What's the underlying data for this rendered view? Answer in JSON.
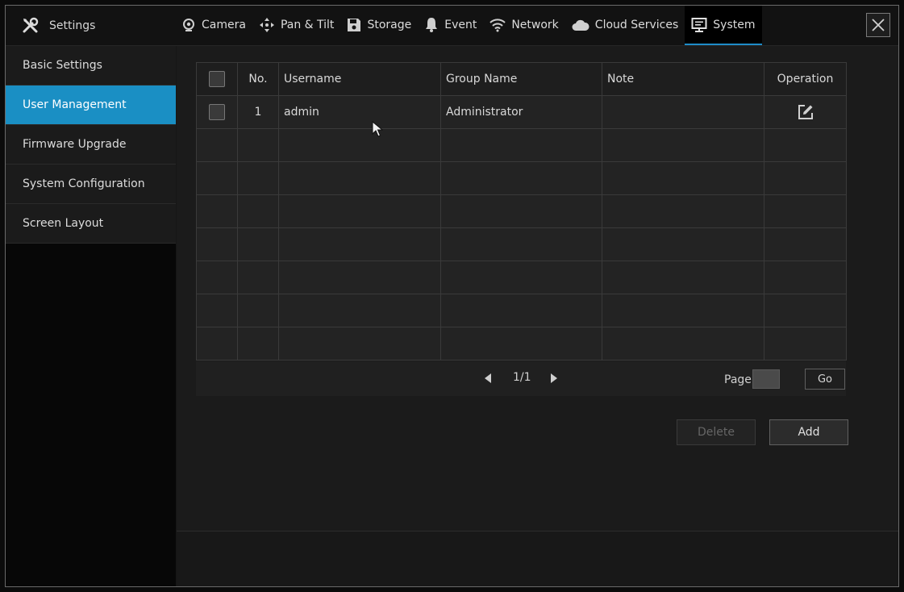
{
  "header": {
    "title": "Settings",
    "tabs": [
      {
        "label": "Camera",
        "icon": "camera-icon"
      },
      {
        "label": "Pan & Tilt",
        "icon": "pan-tilt-icon"
      },
      {
        "label": "Storage",
        "icon": "storage-icon"
      },
      {
        "label": "Event",
        "icon": "bell-icon"
      },
      {
        "label": "Network",
        "icon": "wifi-icon"
      },
      {
        "label": "Cloud Services",
        "icon": "cloud-icon"
      },
      {
        "label": "System",
        "icon": "monitor-icon",
        "active": true
      }
    ]
  },
  "sidebar": {
    "items": [
      {
        "label": "Basic Settings"
      },
      {
        "label": "User Management",
        "active": true
      },
      {
        "label": "Firmware Upgrade"
      },
      {
        "label": "System Configuration"
      },
      {
        "label": "Screen Layout"
      }
    ]
  },
  "table": {
    "columns": [
      "",
      "No.",
      "Username",
      "Group Name",
      "Note",
      "Operation"
    ],
    "rows": [
      {
        "no": "1",
        "username": "admin",
        "group": "Administrator",
        "note": ""
      }
    ]
  },
  "pager": {
    "text": "1/1",
    "page_label": "Page",
    "go_label": "Go"
  },
  "actions": {
    "delete_label": "Delete",
    "add_label": "Add"
  },
  "colors": {
    "accent": "#1a8fc4",
    "background": "#1b1b1b"
  }
}
